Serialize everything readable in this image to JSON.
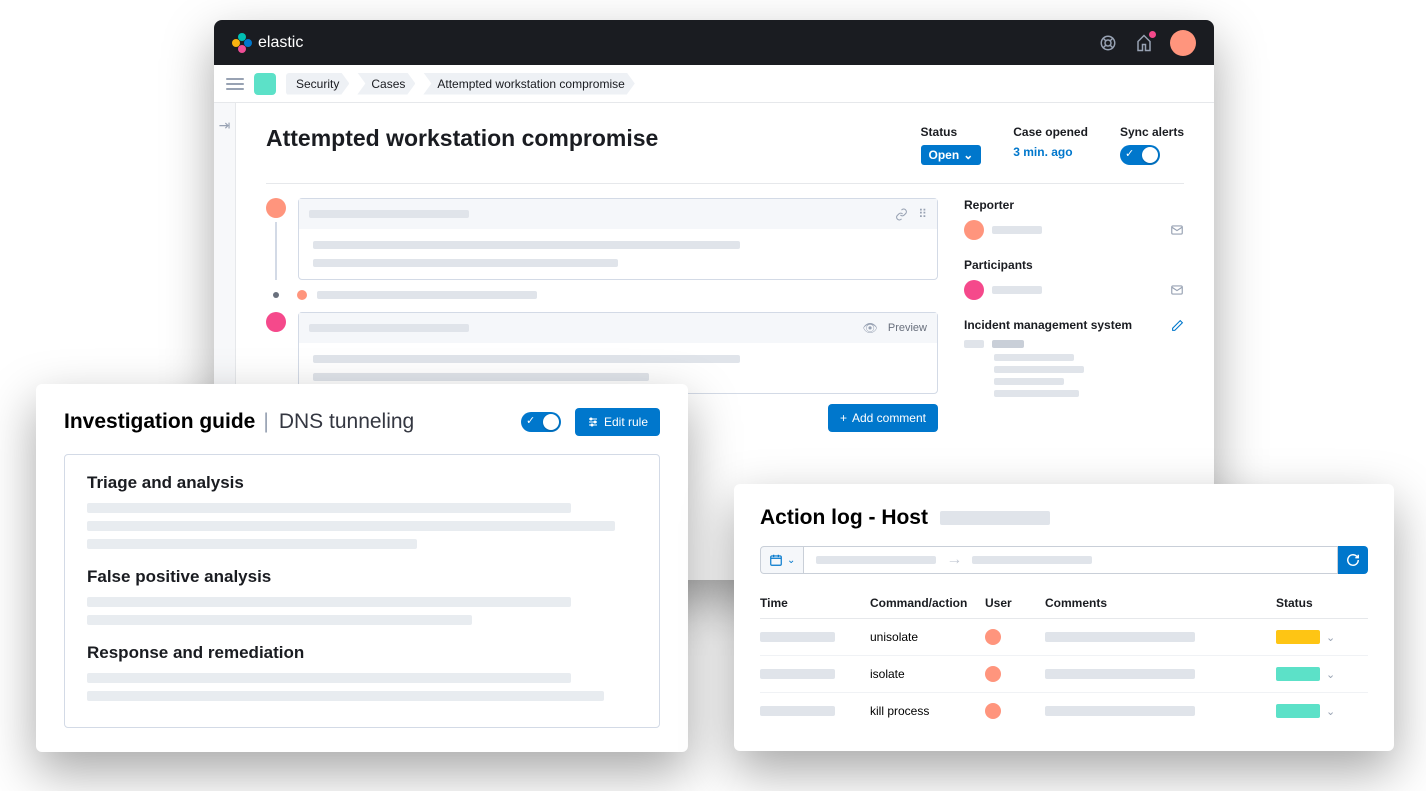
{
  "brand": "elastic",
  "breadcrumbs": [
    "Security",
    "Cases",
    "Attempted workstation compromise"
  ],
  "page": {
    "title": "Attempted workstation compromise",
    "status_label": "Status",
    "status_value": "Open",
    "opened_label": "Case opened",
    "opened_value": "3 min. ago",
    "sync_label": "Sync alerts"
  },
  "timeline": {
    "preview_label": "Preview",
    "add_comment": "Add comment"
  },
  "sidebar": {
    "reporter_label": "Reporter",
    "participants_label": "Participants",
    "ims_label": "Incident management system"
  },
  "ig": {
    "title": "Investigation guide",
    "subject": "DNS tunneling",
    "edit_btn": "Edit rule",
    "sections": [
      "Triage and analysis",
      "False positive analysis",
      "Response and remediation"
    ]
  },
  "al": {
    "title": "Action log - Host",
    "headers": {
      "time": "Time",
      "cmd": "Command/action",
      "user": "User",
      "comments": "Comments",
      "status": "Status"
    },
    "rows": [
      {
        "cmd": "unisolate",
        "status": "yellow"
      },
      {
        "cmd": "isolate",
        "status": "teal"
      },
      {
        "cmd": "kill process",
        "status": "teal"
      }
    ]
  }
}
